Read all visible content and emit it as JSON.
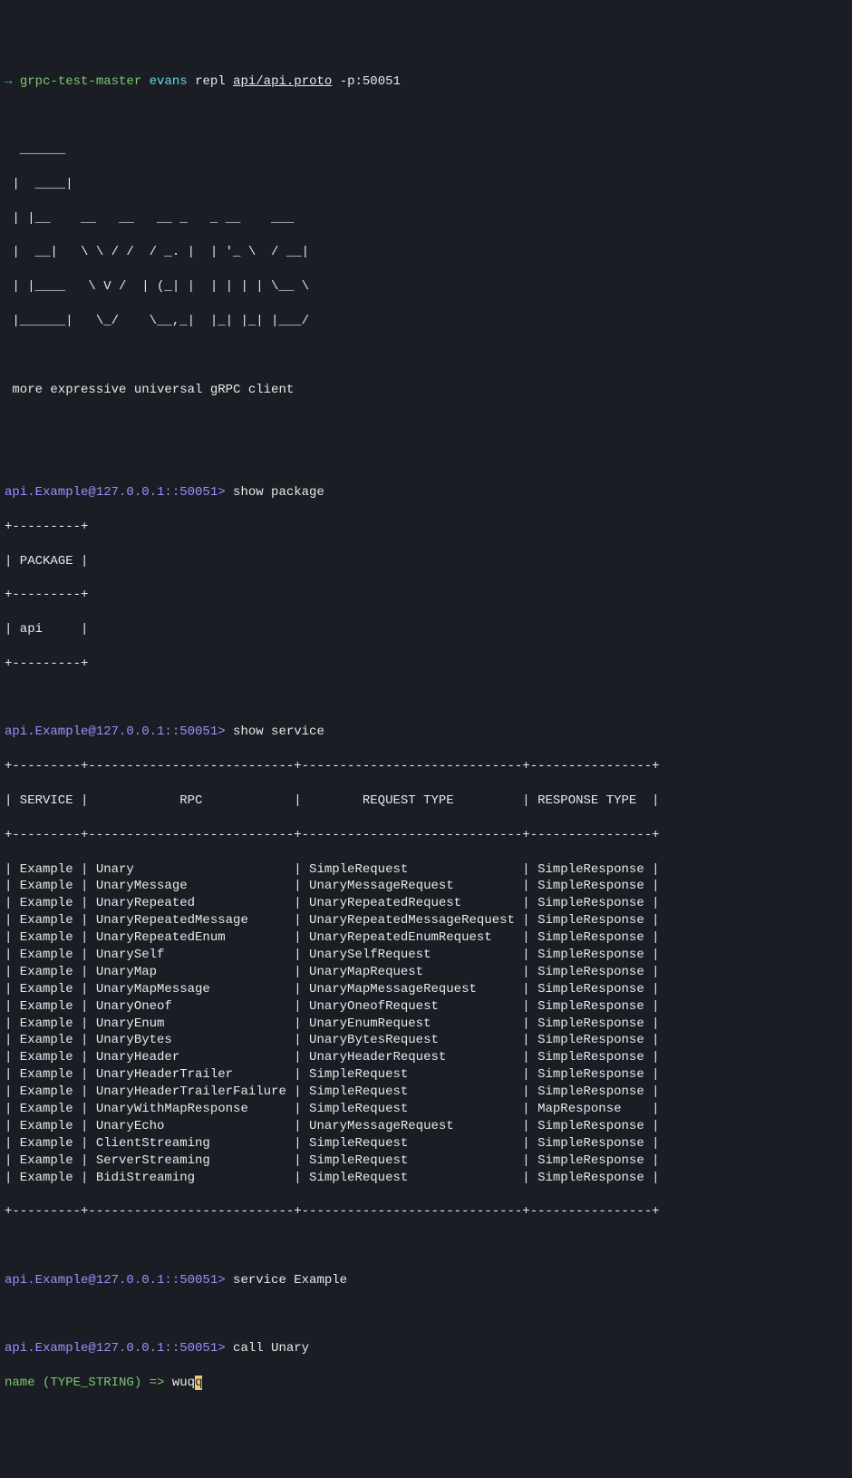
{
  "shell_prompt": {
    "arrow": "→",
    "dir": "grpc-test-master",
    "cmd": "evans",
    "sub": "repl",
    "proto": "api/api.proto",
    "flags": "-p:50051"
  },
  "banner": {
    "line1": "  ______",
    "line2": " |  ____|",
    "line3": " | |__    __   __   __ _   _ __    ___",
    "line4": " |  __|   \\ \\ / /  / _. |  | '_ \\  / __|",
    "line5": " | |____   \\ V /  | (_| |  | | | | \\__ \\",
    "line6": " |______|   \\_/    \\__,_|  |_| |_| |___/",
    "line7": "",
    "tagline": " more expressive universal gRPC client"
  },
  "repl_prompt_text": "api.Example@127.0.0.1::50051>",
  "repl_prompt_gt": ">",
  "commands": {
    "show_package": "show package",
    "show_service": "show service",
    "service_example": "service Example",
    "call_unary": "call Unary"
  },
  "package_table": {
    "border_top": "+---------+",
    "header": "| PACKAGE |",
    "border_mid": "+---------+",
    "row1": "| api     |",
    "border_bot": "+---------+"
  },
  "service_table": {
    "border": "+---------+---------------------------+-----------------------------+----------------+",
    "header": "| SERVICE |            RPC            |        REQUEST TYPE         | RESPONSE TYPE  |",
    "rows": [
      "| Example | Unary                     | SimpleRequest               | SimpleResponse |",
      "| Example | UnaryMessage              | UnaryMessageRequest         | SimpleResponse |",
      "| Example | UnaryRepeated             | UnaryRepeatedRequest        | SimpleResponse |",
      "| Example | UnaryRepeatedMessage      | UnaryRepeatedMessageRequest | SimpleResponse |",
      "| Example | UnaryRepeatedEnum         | UnaryRepeatedEnumRequest    | SimpleResponse |",
      "| Example | UnarySelf                 | UnarySelfRequest            | SimpleResponse |",
      "| Example | UnaryMap                  | UnaryMapRequest             | SimpleResponse |",
      "| Example | UnaryMapMessage           | UnaryMapMessageRequest      | SimpleResponse |",
      "| Example | UnaryOneof                | UnaryOneofRequest           | SimpleResponse |",
      "| Example | UnaryEnum                 | UnaryEnumRequest            | SimpleResponse |",
      "| Example | UnaryBytes                | UnaryBytesRequest           | SimpleResponse |",
      "| Example | UnaryHeader               | UnaryHeaderRequest          | SimpleResponse |",
      "| Example | UnaryHeaderTrailer        | SimpleRequest               | SimpleResponse |",
      "| Example | UnaryHeaderTrailerFailure | SimpleRequest               | SimpleResponse |",
      "| Example | UnaryWithMapResponse      | SimpleRequest               | MapResponse    |",
      "| Example | UnaryEcho                 | UnaryMessageRequest         | SimpleResponse |",
      "| Example | ClientStreaming           | SimpleRequest               | SimpleResponse |",
      "| Example | ServerStreaming           | SimpleRequest               | SimpleResponse |",
      "| Example | BidiStreaming             | SimpleRequest               | SimpleResponse |"
    ]
  },
  "input_prompt": {
    "label": "name (TYPE_STRING) =>",
    "value": "wuq",
    "cursor": "q"
  }
}
